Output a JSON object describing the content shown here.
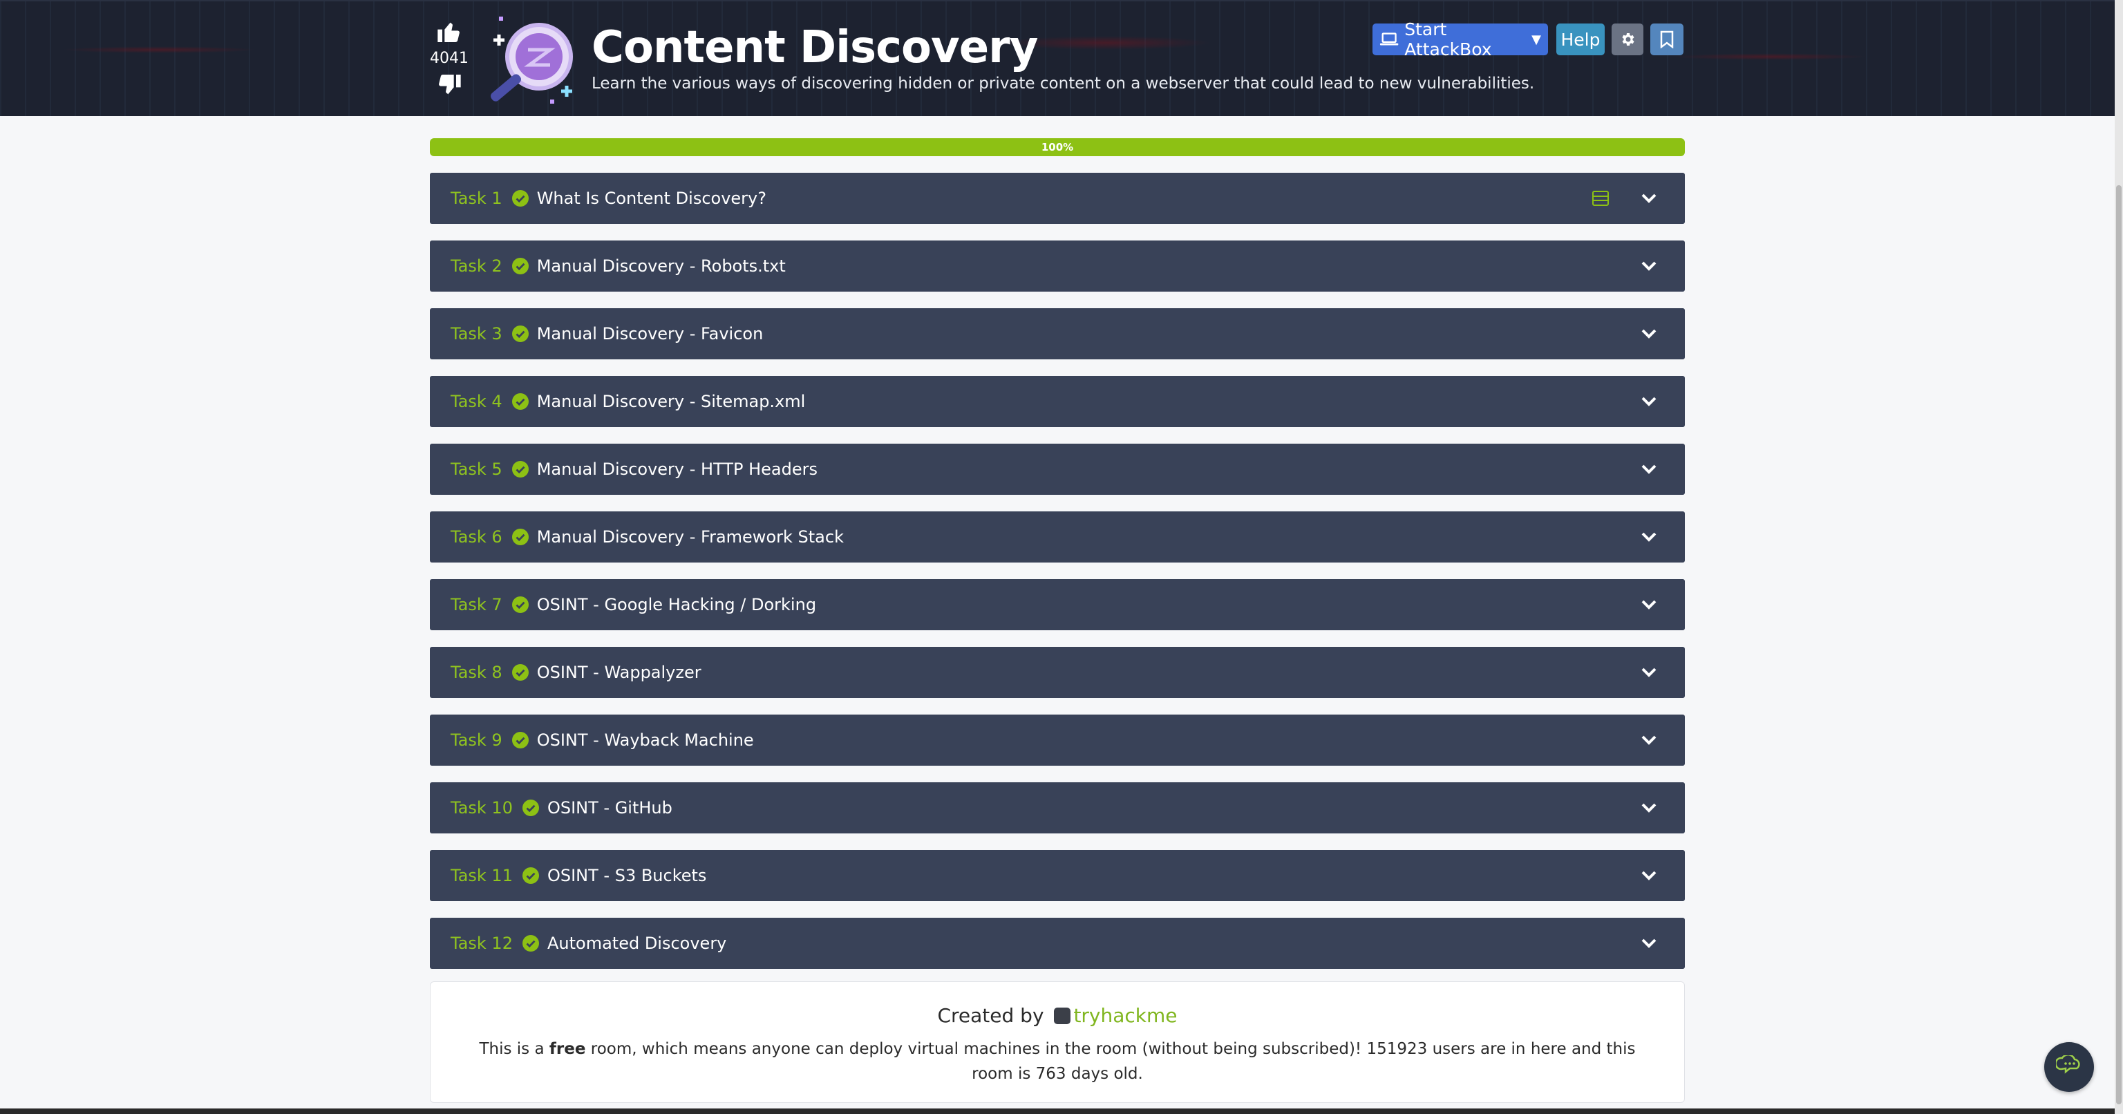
{
  "header": {
    "vote_count": "4041",
    "title": "Content Discovery",
    "description": "Learn the various ways of discovering hidden or private content on a webserver that could lead to new vulnerabilities.",
    "attackbox_label": "Start AttackBox",
    "help_label": "Help"
  },
  "progress": {
    "percent_label": "100%",
    "fraction": 1.0
  },
  "tasks": [
    {
      "number": "Task 1",
      "title": "What Is Content Discovery?"
    },
    {
      "number": "Task 2",
      "title": "Manual Discovery - Robots.txt"
    },
    {
      "number": "Task 3",
      "title": "Manual Discovery - Favicon"
    },
    {
      "number": "Task 4",
      "title": "Manual Discovery - Sitemap.xml"
    },
    {
      "number": "Task 5",
      "title": "Manual Discovery - HTTP Headers"
    },
    {
      "number": "Task 6",
      "title": "Manual Discovery - Framework Stack"
    },
    {
      "number": "Task 7",
      "title": "OSINT - Google Hacking / Dorking"
    },
    {
      "number": "Task 8",
      "title": "OSINT - Wappalyzer"
    },
    {
      "number": "Task 9",
      "title": "OSINT - Wayback Machine"
    },
    {
      "number": "Task 10",
      "title": "OSINT - GitHub"
    },
    {
      "number": "Task 11",
      "title": "OSINT - S3 Buckets"
    },
    {
      "number": "Task 12",
      "title": "Automated Discovery"
    }
  ],
  "footer": {
    "created_by": "Created by",
    "author": "tryhackme",
    "text_before": "This is a ",
    "text_bold": "free",
    "text_after": " room, which means anyone can deploy virtual machines in the room (without being subscribed)! 151923 users are in here and this room is 763 days old."
  },
  "colors": {
    "accent_green": "#8dc114",
    "task_bg": "#394258",
    "attackbox_blue": "#3f6ed9"
  },
  "icons": [
    "thumbs-up-icon",
    "thumbs-down-icon",
    "magnifier-room-icon",
    "laptop-icon",
    "caret-down-icon",
    "gear-icon",
    "bookmark-icon",
    "check-circle-icon",
    "notes-icon",
    "chevron-down-icon",
    "chat-icon"
  ]
}
